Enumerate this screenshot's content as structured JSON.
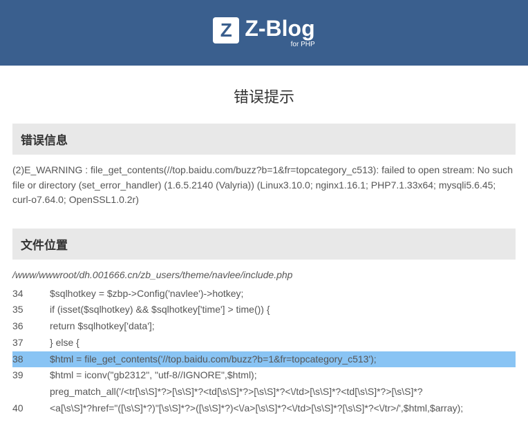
{
  "header": {
    "logo_letter": "Z",
    "logo_text": "Z-Blog",
    "logo_sub": "for PHP"
  },
  "page_title": "错误提示",
  "error_section": {
    "title": "错误信息",
    "message": "(2)E_WARNING : file_get_contents(//top.baidu.com/buzz?b=1&fr=topcategory_c513): failed to open stream: No such file or directory (set_error_handler) (1.6.5.2140 (Valyria)) (Linux3.10.0; nginx1.16.1; PHP7.1.33x64; mysqli5.6.45; curl-o7.64.0; OpenSSL1.0.2r)"
  },
  "file_section": {
    "title": "文件位置",
    "file_path": "/www/wwwroot/dh.001666.cn/zb_users/theme/navlee/include.php",
    "lines": [
      {
        "n": "34",
        "c": "$sqlhotkey = $zbp->Config('navlee')->hotkey;",
        "hl": false
      },
      {
        "n": "35",
        "c": "if (isset($sqlhotkey) && $sqlhotkey['time'] > time()) {",
        "hl": false
      },
      {
        "n": "36",
        "c": "return $sqlhotkey['data'];",
        "hl": false
      },
      {
        "n": "37",
        "c": "} else {",
        "hl": false
      },
      {
        "n": "38",
        "c": "$html = file_get_contents('//top.baidu.com/buzz?b=1&fr=topcategory_c513');",
        "hl": true
      },
      {
        "n": "39",
        "c": "$html = iconv(\"gb2312\", \"utf-8//IGNORE\",$html);",
        "hl": false
      },
      {
        "n": "",
        "c": "preg_match_all('/<tr[\\s\\S]*?>[\\s\\S]*?<td[\\s\\S]*?>[\\s\\S]*?<\\/td>[\\s\\S]*?<td[\\s\\S]*?>[\\s\\S]*?",
        "hl": false
      },
      {
        "n": "40",
        "c": "<a[\\s\\S]*?href=\"([\\s\\S]*?)\"[\\s\\S]*?>([\\s\\S]*?)<\\/a>[\\s\\S]*?<\\/td>[\\s\\S]*?[\\s\\S]*?<\\/tr>/',$html,$array);",
        "hl": false
      }
    ]
  }
}
